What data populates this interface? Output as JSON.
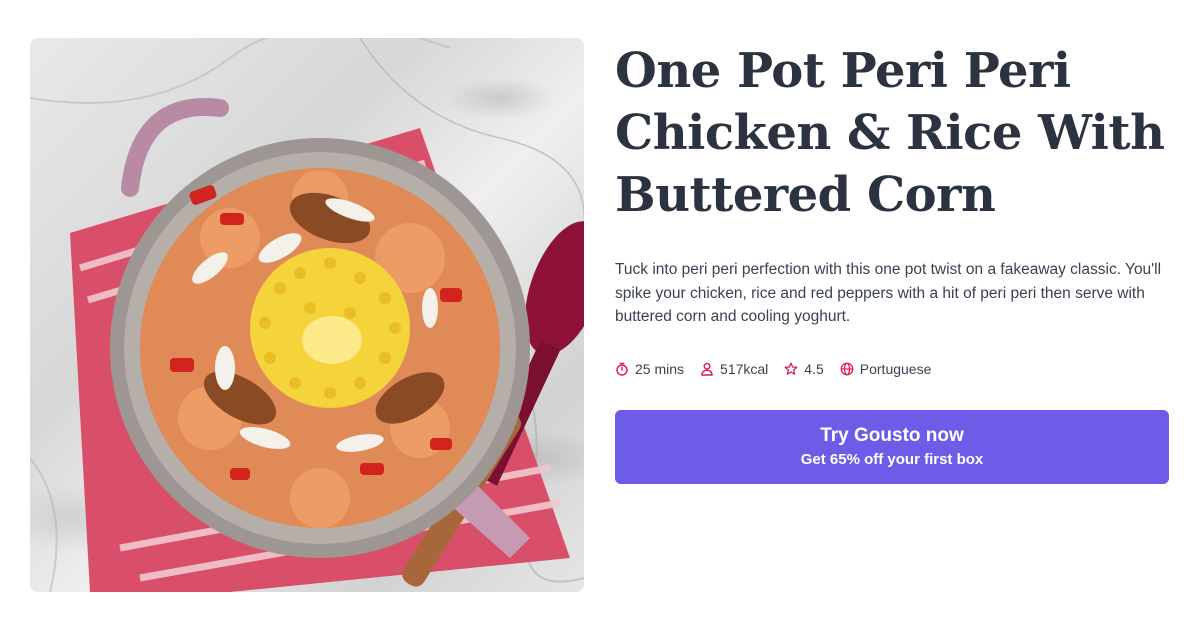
{
  "recipe": {
    "title": "One Pot Peri Peri Chicken & Rice With Buttered Corn",
    "description": "Tuck into peri peri perfection with this one pot twist on a fakeaway classic. You'll spike your chicken, rice and red peppers with a hit of peri peri then serve with buttered corn and cooling yoghurt.",
    "image_icon": "recipe-photo",
    "meta": {
      "time": "25 mins",
      "time_icon": "stopwatch-icon",
      "calories": "517kcal",
      "calories_icon": "person-icon",
      "rating": "4.5",
      "rating_icon": "star-icon",
      "cuisine": "Portuguese",
      "cuisine_icon": "globe-icon"
    }
  },
  "cta": {
    "label": "Try Gousto now",
    "sublabel": "Get 65% off your first box"
  },
  "colors": {
    "accent": "#6c5ce7",
    "icon": "#e3184b",
    "heading": "#2b3340"
  }
}
